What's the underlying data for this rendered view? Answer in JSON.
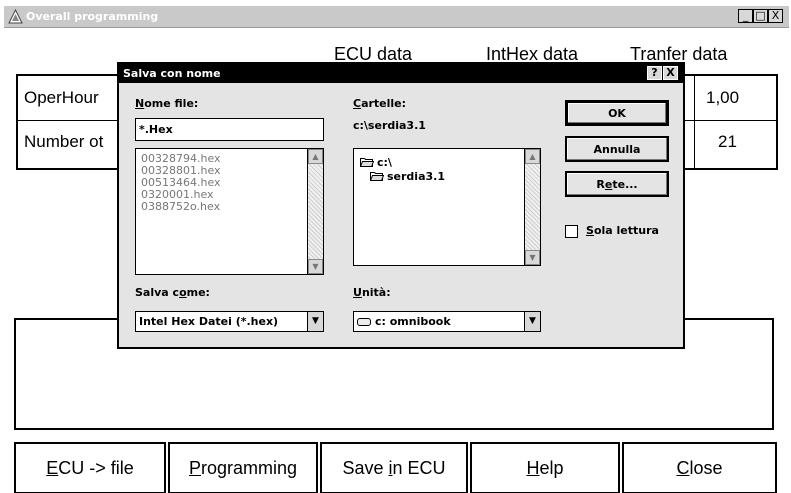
{
  "window": {
    "title": "Overall programming",
    "controls": {
      "minimize": "_",
      "maximize": "□",
      "close": "X"
    }
  },
  "columns": {
    "ecu_data": "ECU data",
    "inthex_data": "IntHex data",
    "transfer_data": "Tranfer data"
  },
  "rows": [
    {
      "label": "OperHour",
      "transfer": "1,00"
    },
    {
      "label": "Number ot",
      "transfer": "21"
    }
  ],
  "buttons": {
    "ecu_to_file": {
      "mnemonic": "E",
      "rest": "CU -> file"
    },
    "programming": {
      "mnemonic": "P",
      "rest": "rogramming"
    },
    "save_in_ecu": {
      "pre": "Save ",
      "mnemonic": "i",
      "rest": "n ECU"
    },
    "help": {
      "mnemonic": "H",
      "rest": "elp"
    },
    "close": {
      "mnemonic": "C",
      "rest": "lose"
    }
  },
  "dialog": {
    "title": "Salva con nome",
    "title_buttons": {
      "help": "?",
      "close": "X"
    },
    "filename_label": {
      "mnemonic": "N",
      "rest": "ome file:"
    },
    "filename_value": "*.Hex",
    "files": [
      "00328794.hex",
      "00328801.hex",
      "00513464.hex",
      "0320001.hex",
      "0388752o.hex"
    ],
    "folders_label": {
      "mnemonic": "C",
      "rest": "artelle:"
    },
    "current_folder": "c:\\serdia3.1",
    "folders": [
      "c:\\",
      "serdia3.1"
    ],
    "savetype_label": {
      "pre": "Salva c",
      "mnemonic": "o",
      "rest": "me:"
    },
    "savetype_value": "Intel Hex Datei (*.hex)",
    "drive_label": {
      "mnemonic": "U",
      "rest": "nità:"
    },
    "drive_value": "c: omnibook",
    "ok": "OK",
    "cancel": "Annulla",
    "network": {
      "pre": "R",
      "mnemonic": "e",
      "rest": "te..."
    },
    "readonly": {
      "mnemonic": "S",
      "rest": "ola lettura",
      "checked": false
    }
  }
}
